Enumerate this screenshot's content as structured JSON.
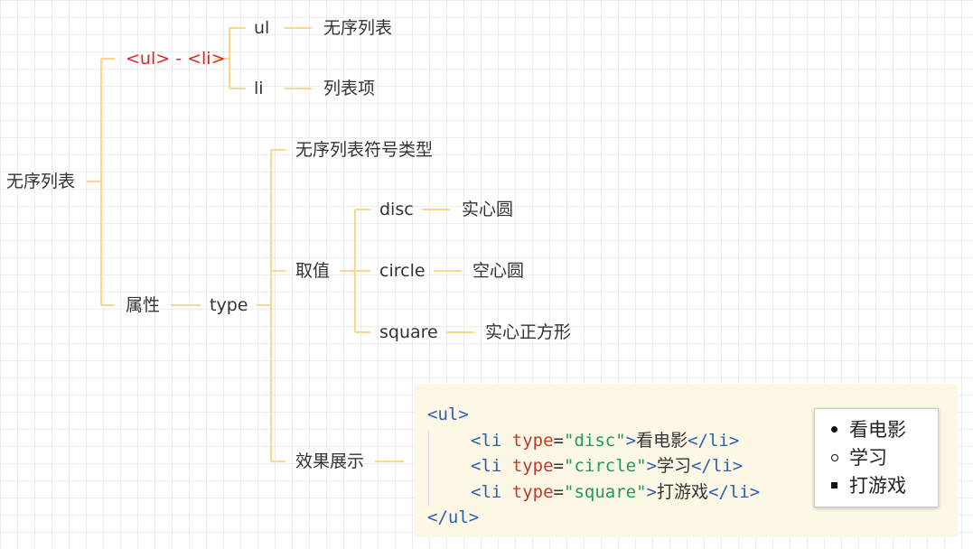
{
  "mindmap": {
    "root": "无序列表",
    "tags_branch": "<ul> - <li>",
    "ul": "ul",
    "ul_desc": "无序列表",
    "li": "li",
    "li_desc": "列表项",
    "attr_branch": "属性",
    "type": "type",
    "symbol_types": "无序列表符号类型",
    "values": "取值",
    "disc": "disc",
    "disc_desc": "实心圆",
    "circle": "circle",
    "circle_desc": "空心圆",
    "square": "square",
    "square_desc": "实心正方形",
    "demo": "效果展示",
    "highlight_color": "#e02424",
    "connector_color": "#fcd68a"
  },
  "code": {
    "open_ul": "<ul>",
    "close_ul": "</ul>",
    "items": [
      {
        "open": "<li",
        "attr": "type",
        "eq": "=",
        "value": "\"disc\"",
        "gt": ">",
        "text": "看电影",
        "close": "</li>"
      },
      {
        "open": "<li",
        "attr": "type",
        "eq": "=",
        "value": "\"circle\"",
        "gt": ">",
        "text": "学习",
        "close": "</li>"
      },
      {
        "open": "<li",
        "attr": "type",
        "eq": "=",
        "value": "\"square\"",
        "gt": ">",
        "text": "打游戏",
        "close": "</li>"
      }
    ]
  },
  "preview": {
    "items": [
      {
        "bullet": "disc",
        "text": "看电影"
      },
      {
        "bullet": "circle",
        "text": "学习"
      },
      {
        "bullet": "square",
        "text": "打游戏"
      }
    ]
  }
}
